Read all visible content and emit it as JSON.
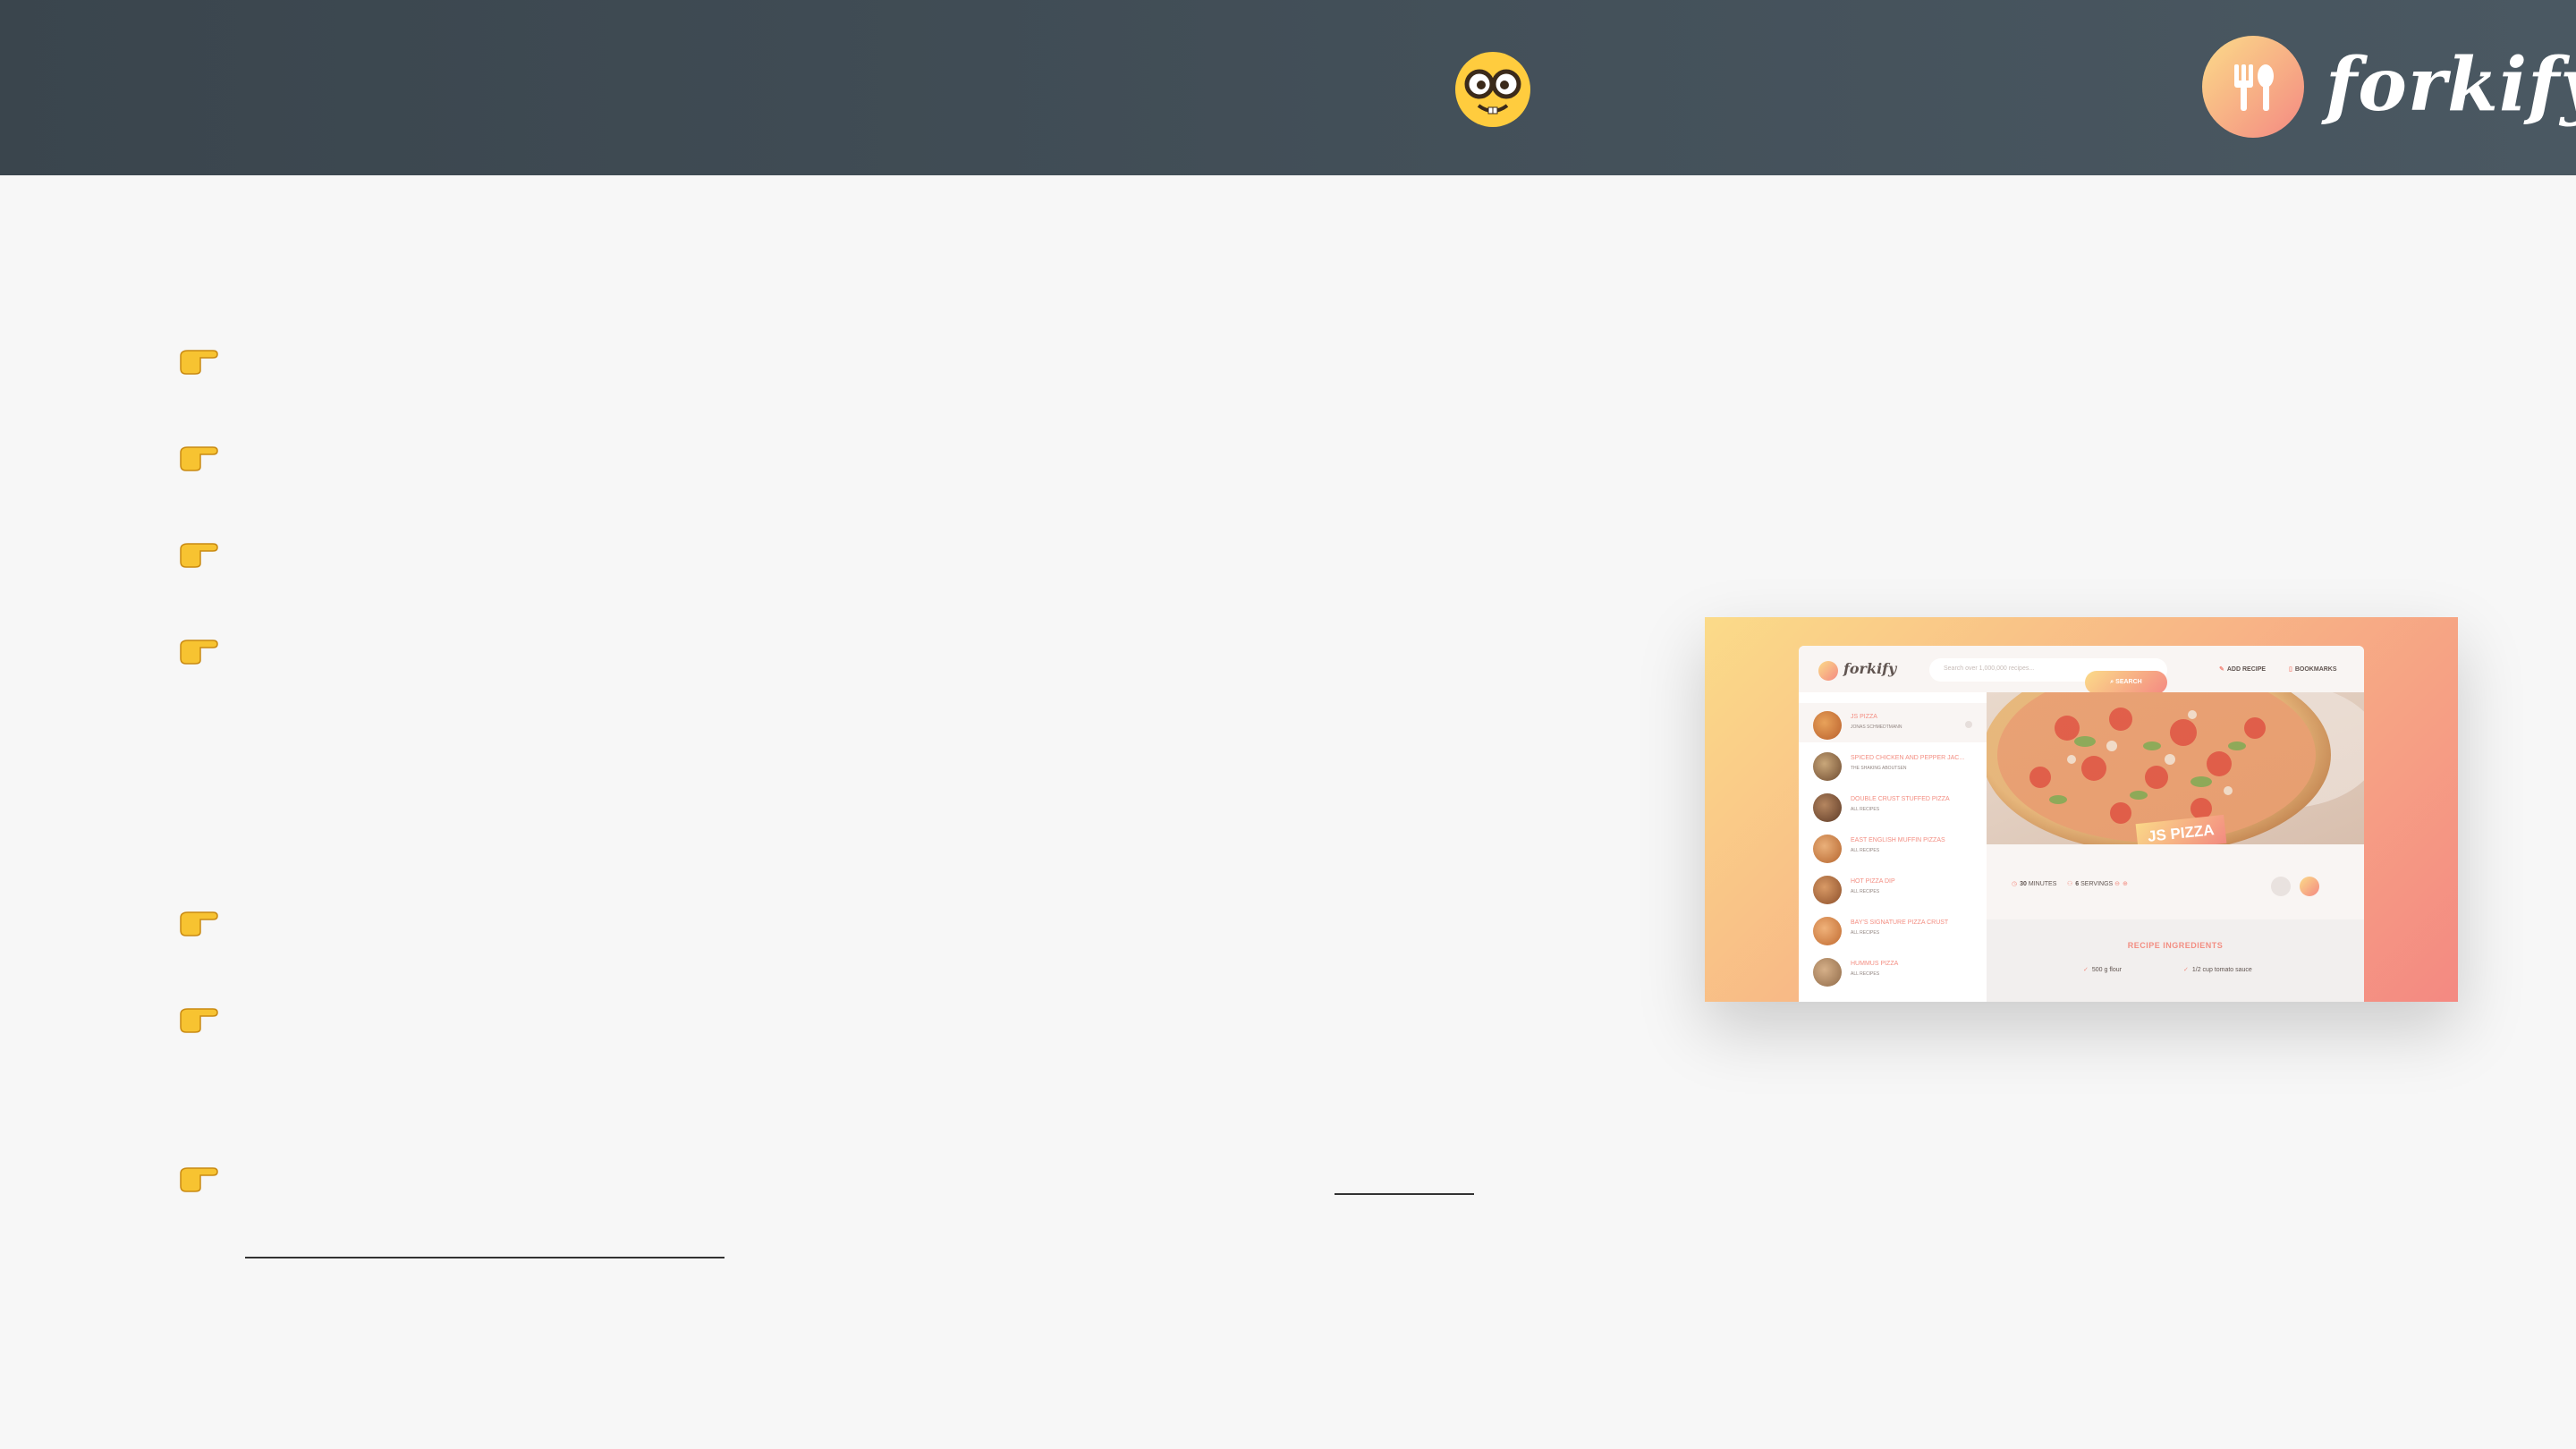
{
  "header": {
    "emoji": "🤓",
    "brand_name": "forkify",
    "brand_icon": "fork-spoon-icon"
  },
  "bullets": [
    {
      "icon": "👉"
    },
    {
      "icon": "👉"
    },
    {
      "icon": "👉"
    },
    {
      "icon": "👉"
    },
    {
      "icon": "👉"
    },
    {
      "icon": "👉"
    },
    {
      "icon": "👉"
    }
  ],
  "preview": {
    "logo_text": "forkify",
    "search_placeholder": "Search over 1,000,000 recipes...",
    "search_button": "SEARCH",
    "nav_add_recipe": "ADD RECIPE",
    "nav_bookmarks": "BOOKMARKS",
    "results": [
      {
        "title": "JS PIZZA",
        "publisher": "JONAS SCHMEDTMANN"
      },
      {
        "title": "SPICED CHICKEN AND PEPPER JAC...",
        "publisher": "THE SHAKING ABOUTSEN"
      },
      {
        "title": "DOUBLE CRUST STUFFED PIZZA",
        "publisher": "ALL RECIPES"
      },
      {
        "title": "EAST ENGLISH MUFFIN PIZZAS",
        "publisher": "ALL RECIPES"
      },
      {
        "title": "HOT PIZZA DIP",
        "publisher": "ALL RECIPES"
      },
      {
        "title": "BAY'S SIGNATURE PIZZA CRUST",
        "publisher": "ALL RECIPES"
      },
      {
        "title": "HUMMUS PIZZA",
        "publisher": "ALL RECIPES"
      }
    ],
    "recipe_title": "JS PIZZA",
    "minutes_value": "30",
    "minutes_label": "MINUTES",
    "servings_value": "6",
    "servings_label": "SERVINGS",
    "ingredients_heading": "RECIPE INGREDIENTS",
    "ingredients": [
      "500 g flour",
      "1/2 cup tomato sauce"
    ]
  },
  "colors": {
    "accent_start": "#fbdb89",
    "accent_end": "#f48982",
    "header_bg": "#3a454d"
  }
}
